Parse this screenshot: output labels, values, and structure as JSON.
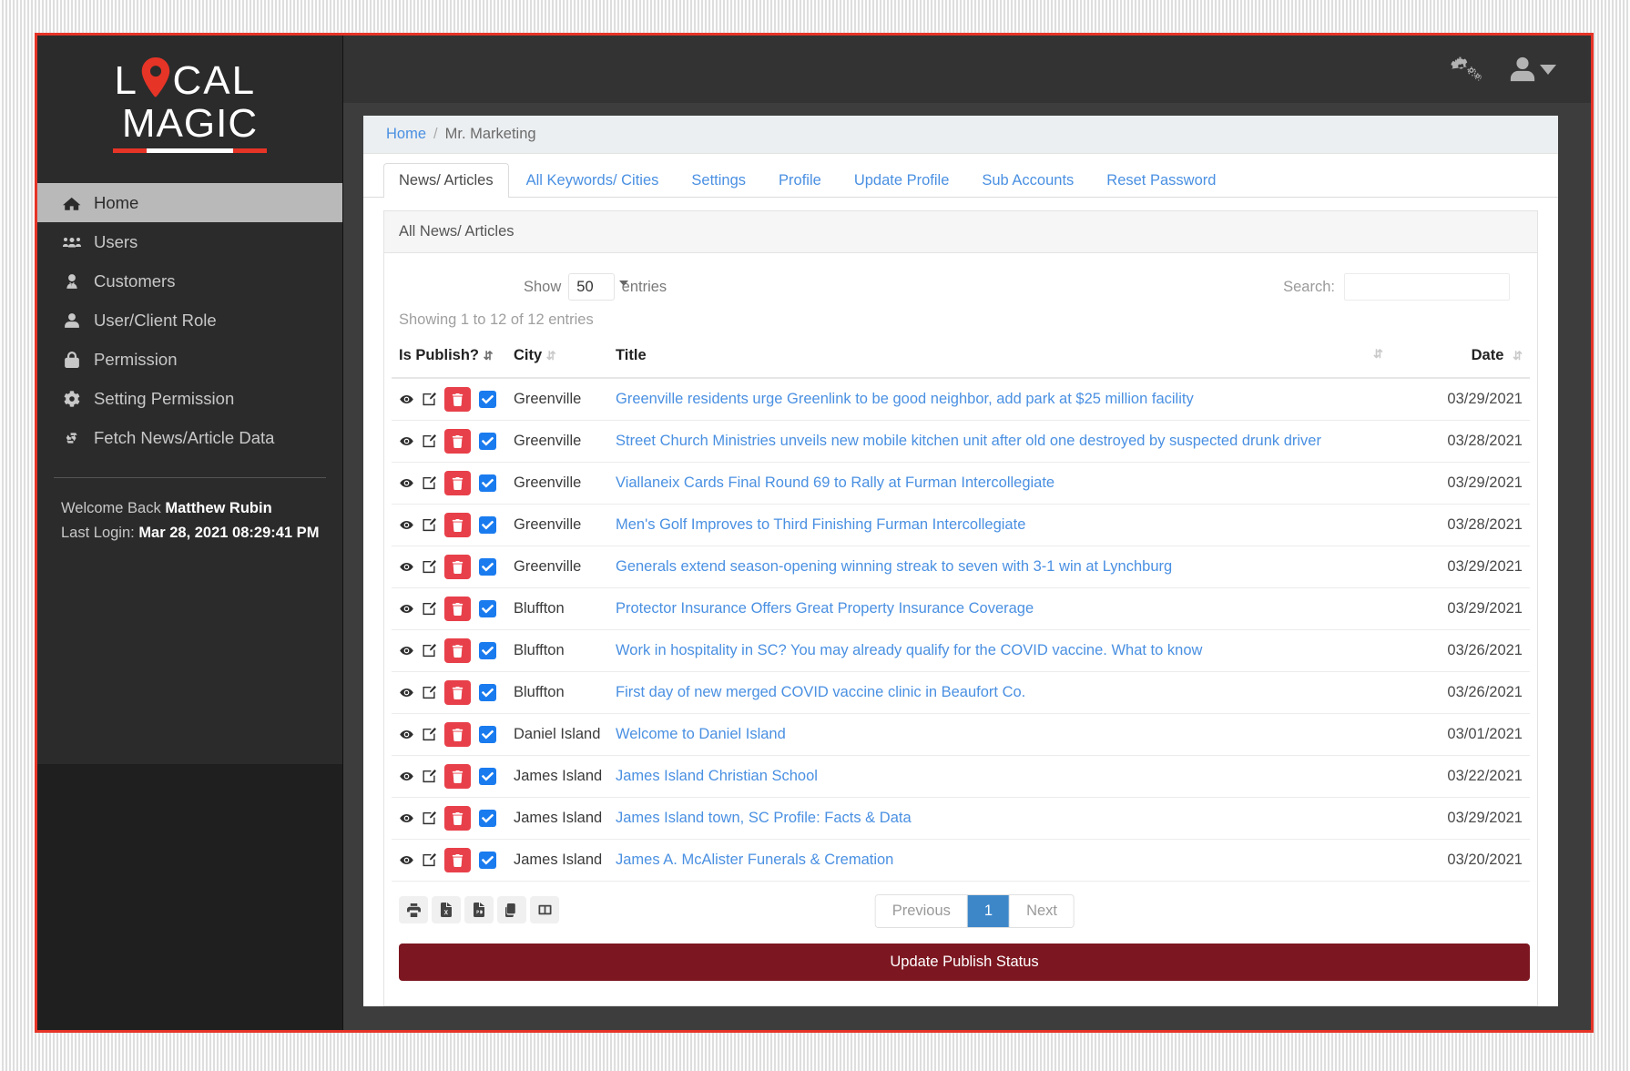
{
  "brand": {
    "line1_left": "L",
    "line1_right": "CAL",
    "line2": "MAGIC",
    "pin_color": "#e63427"
  },
  "sidebar": {
    "items": [
      {
        "label": "Home",
        "icon": "home-icon",
        "active": true
      },
      {
        "label": "Users",
        "icon": "users-icon",
        "active": false
      },
      {
        "label": "Customers",
        "icon": "user-tie-icon",
        "active": false
      },
      {
        "label": "User/Client Role",
        "icon": "user-icon",
        "active": false
      },
      {
        "label": "Permission",
        "icon": "lock-icon",
        "active": false
      },
      {
        "label": "Setting Permission",
        "icon": "gear-icon",
        "active": false
      },
      {
        "label": "Fetch News/Article Data",
        "icon": "recycle-icon",
        "active": false
      }
    ],
    "welcome_prefix": "Welcome Back ",
    "welcome_user": "Matthew Rubin",
    "last_login_label": "Last Login: ",
    "last_login_value": "Mar 28, 2021 08:29:41 PM"
  },
  "topbar": {
    "settings_icon": "cogs-icon",
    "account_icon": "user-icon"
  },
  "breadcrumb": {
    "home": "Home",
    "separator": "/",
    "current": "Mr. Marketing"
  },
  "tabs": [
    {
      "label": "News/ Articles",
      "active": true
    },
    {
      "label": "All Keywords/ Cities",
      "active": false
    },
    {
      "label": "Settings",
      "active": false
    },
    {
      "label": "Profile",
      "active": false
    },
    {
      "label": "Update Profile",
      "active": false
    },
    {
      "label": "Sub Accounts",
      "active": false
    },
    {
      "label": "Reset Password",
      "active": false
    }
  ],
  "panel": {
    "title": "All News/ Articles"
  },
  "datatable": {
    "show_label": "Show",
    "page_length": "50",
    "entries_label": "entries",
    "search_label": "Search:",
    "search_value": "",
    "search_placeholder": "",
    "info": "Showing 1 to 12 of 12 entries",
    "columns": [
      "Is Publish?",
      "City",
      "Title",
      "Date"
    ],
    "rows": [
      {
        "city": "Greenville",
        "title": "Greenville residents urge Greenlink to be good neighbor, add park at $25 million facility",
        "date": "03/29/2021",
        "published": true
      },
      {
        "city": "Greenville",
        "title": "Street Church Ministries unveils new mobile kitchen unit after old one destroyed by suspected drunk driver",
        "date": "03/28/2021",
        "published": true
      },
      {
        "city": "Greenville",
        "title": "Viallaneix Cards Final Round 69 to Rally at Furman Intercollegiate",
        "date": "03/29/2021",
        "published": true
      },
      {
        "city": "Greenville",
        "title": "Men's Golf Improves to Third Finishing Furman Intercollegiate",
        "date": "03/28/2021",
        "published": true
      },
      {
        "city": "Greenville",
        "title": "Generals extend season-opening winning streak to seven with 3-1 win at Lynchburg",
        "date": "03/29/2021",
        "published": true
      },
      {
        "city": "Bluffton",
        "title": "Protector Insurance Offers Great Property Insurance Coverage",
        "date": "03/29/2021",
        "published": true
      },
      {
        "city": "Bluffton",
        "title": "Work in hospitality in SC? You may already qualify for the COVID vaccine. What to know",
        "date": "03/26/2021",
        "published": true
      },
      {
        "city": "Bluffton",
        "title": "First day of new merged COVID vaccine clinic in Beaufort Co.",
        "date": "03/26/2021",
        "published": true
      },
      {
        "city": "Daniel Island",
        "title": "Welcome to Daniel Island",
        "date": "03/01/2021",
        "published": true
      },
      {
        "city": "James Island",
        "title": "James Island Christian School",
        "date": "03/22/2021",
        "published": true
      },
      {
        "city": "James Island",
        "title": "James Island town, SC Profile: Facts & Data",
        "date": "03/29/2021",
        "published": true
      },
      {
        "city": "James Island",
        "title": "James A. McAlister Funerals & Cremation",
        "date": "03/20/2021",
        "published": true
      }
    ],
    "export_buttons": [
      {
        "icon": "print-icon",
        "label": "Print"
      },
      {
        "icon": "excel-file-icon",
        "label": "Excel"
      },
      {
        "icon": "pdf-file-icon",
        "label": "PDF"
      },
      {
        "icon": "copy-icon",
        "label": "Copy"
      },
      {
        "icon": "columns-icon",
        "label": "Column visibility"
      }
    ],
    "pagination": {
      "previous": "Previous",
      "current_page": "1",
      "next": "Next"
    }
  },
  "footer": {
    "update_button": "Update Publish Status"
  },
  "colors": {
    "accent_red": "#e63427",
    "link_blue": "#4a90e2",
    "danger": "#e8404a",
    "dark_red_button": "#7c1620",
    "page_active": "#3d87c9"
  }
}
